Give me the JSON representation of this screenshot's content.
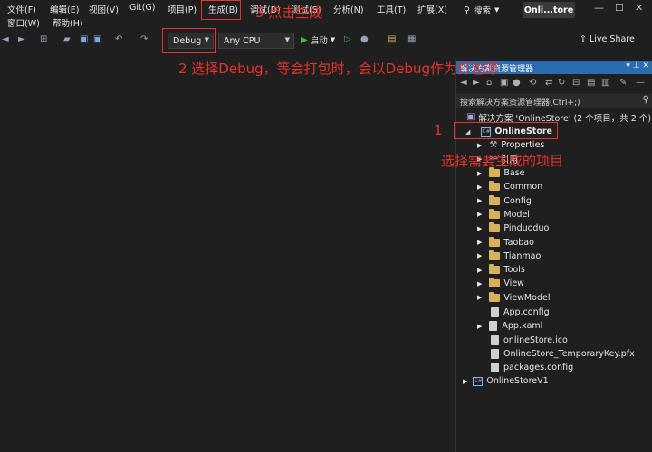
{
  "menu": {
    "file": "文件(F)",
    "edit": "编辑(E)",
    "view": "视图(V)",
    "git": "Git(G)",
    "project": "项目(P)",
    "build": "生成(B)",
    "debug": "调试(D)",
    "test": "测试(S)",
    "analyze": "分析(N)",
    "tools": "工具(T)",
    "extensions": "扩展(X)",
    "window": "窗口(W)",
    "help": "帮助(H)"
  },
  "search": {
    "label": "搜索"
  },
  "solution_title": "Onli...tore",
  "toolbar": {
    "config_value": "Debug",
    "platform_value": "Any CPU",
    "start_label": "启动",
    "live_share": "Live Share"
  },
  "panel": {
    "title": "解决方案资源管理器",
    "search_placeholder": "搜索解决方案资源管理器(Ctrl+;)"
  },
  "tree": {
    "solution": "解决方案 'OnlineStore' (2 个项目，共 2 个)",
    "project": "OnlineStore",
    "properties": "Properties",
    "references": "引用",
    "folders": [
      "Base",
      "Common",
      "Config",
      "Model",
      "Pinduoduo",
      "Taobao",
      "Tianmao",
      "Tools",
      "View",
      "ViewModel"
    ],
    "files": [
      "App.config",
      "App.xaml",
      "onlineStore.ico",
      "OnlineStore_TemporaryKey.pfx",
      "packages.config"
    ],
    "project2": "OnlineStoreV1"
  },
  "annotations": {
    "step3": "3 点击生成",
    "step2": "2 选择Debug，等会打包时，会以Debug作为打包源",
    "step1_num": "1",
    "step1_text": "选择需要生成的项目"
  },
  "colors": {
    "annotation_red": "#e8322d",
    "panel_title_blue": "#2b6cb0",
    "folder_yellow": "#d8b05c",
    "start_green": "#3fb950"
  }
}
